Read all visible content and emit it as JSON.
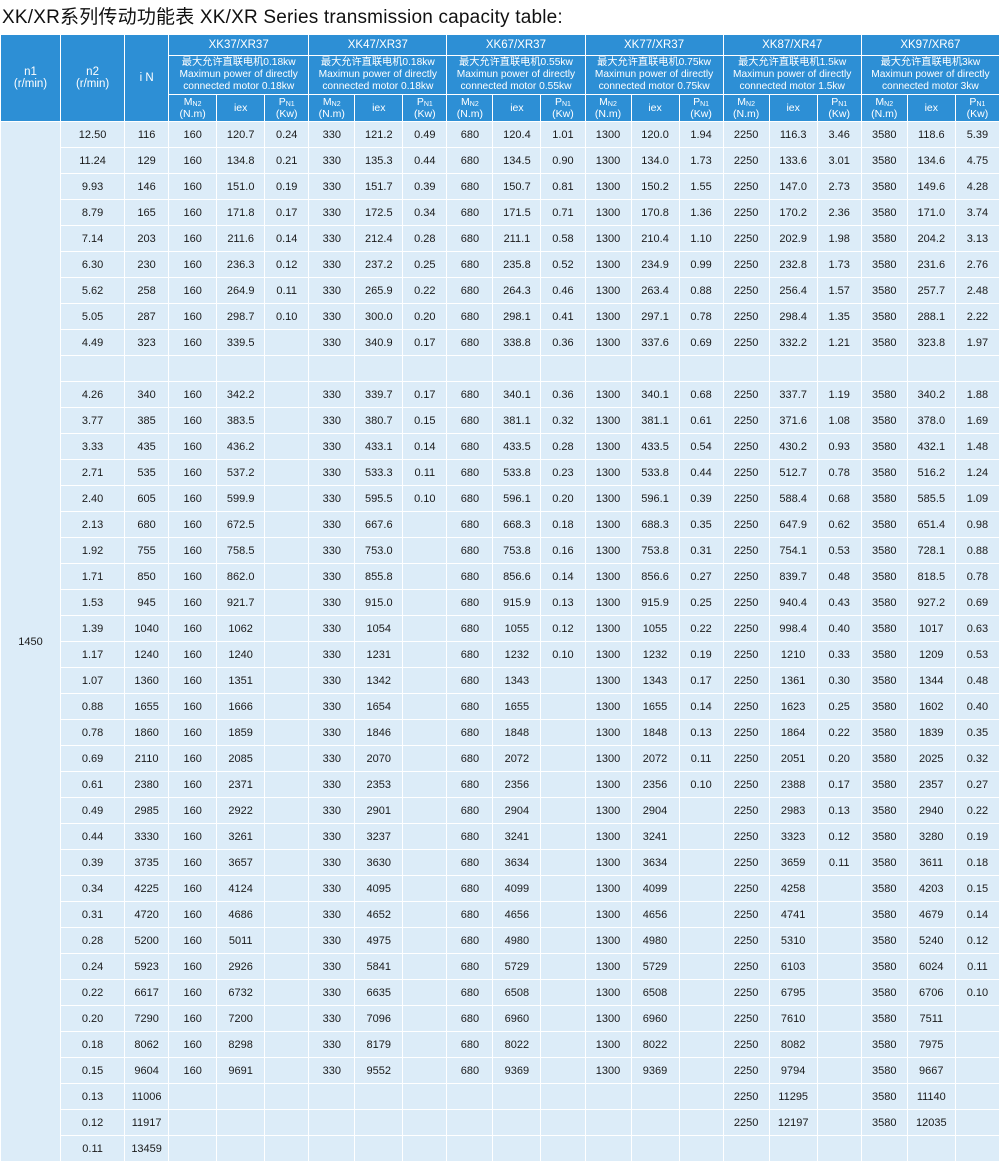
{
  "title": "XK/XR系列传动功能表  XK/XR Series transmission capacity table:",
  "headers": {
    "n1": "n1",
    "n1_unit": "(r/min)",
    "n2": "n2",
    "n2_unit": "(r/min)",
    "iN": "i N",
    "m_sym": "M",
    "m_sub": "N2",
    "m_unit": "(N.m)",
    "iex": "iex",
    "p_sym": "P",
    "p_sub": "N1",
    "p_unit": "(Kw)"
  },
  "models": [
    {
      "name": "XK37/XR37",
      "cn": "最大允许直联电机0.18kw",
      "en1": "Maximun power of directly",
      "en2": "connected motor 0.18kw"
    },
    {
      "name": "XK47/XR37",
      "cn": "最大允许直联电机0.18kw",
      "en1": "Maximun power of directly",
      "en2": "connected motor 0.18kw"
    },
    {
      "name": "XK67/XR37",
      "cn": "最大允许直联电机0.55kw",
      "en1": "Maximun power of directly",
      "en2": "connected motor 0.55kw"
    },
    {
      "name": "XK77/XR37",
      "cn": "最大允许直联电机0.75kw",
      "en1": "Maximun power of directly",
      "en2": "connected motor 0.75kw"
    },
    {
      "name": "XK87/XR47",
      "cn": "最大允许直联电机1.5kw",
      "en1": "Maximun power of directly",
      "en2": "connected motor 1.5kw"
    },
    {
      "name": "XK97/XR67",
      "cn": "最大允许直联电机3kw",
      "en1": "Maximun power of directly",
      "en2": "connected motor 3kw"
    }
  ],
  "n1_value": "1450",
  "rows": [
    [
      "12.50",
      "116",
      "160",
      "120.7",
      "0.24",
      "330",
      "121.2",
      "0.49",
      "680",
      "120.4",
      "1.01",
      "1300",
      "120.0",
      "1.94",
      "2250",
      "116.3",
      "3.46",
      "3580",
      "118.6",
      "5.39"
    ],
    [
      "11.24",
      "129",
      "160",
      "134.8",
      "0.21",
      "330",
      "135.3",
      "0.44",
      "680",
      "134.5",
      "0.90",
      "1300",
      "134.0",
      "1.73",
      "2250",
      "133.6",
      "3.01",
      "3580",
      "134.6",
      "4.75"
    ],
    [
      "9.93",
      "146",
      "160",
      "151.0",
      "0.19",
      "330",
      "151.7",
      "0.39",
      "680",
      "150.7",
      "0.81",
      "1300",
      "150.2",
      "1.55",
      "2250",
      "147.0",
      "2.73",
      "3580",
      "149.6",
      "4.28"
    ],
    [
      "8.79",
      "165",
      "160",
      "171.8",
      "0.17",
      "330",
      "172.5",
      "0.34",
      "680",
      "171.5",
      "0.71",
      "1300",
      "170.8",
      "1.36",
      "2250",
      "170.2",
      "2.36",
      "3580",
      "171.0",
      "3.74"
    ],
    [
      "7.14",
      "203",
      "160",
      "211.6",
      "0.14",
      "330",
      "212.4",
      "0.28",
      "680",
      "211.1",
      "0.58",
      "1300",
      "210.4",
      "1.10",
      "2250",
      "202.9",
      "1.98",
      "3580",
      "204.2",
      "3.13"
    ],
    [
      "6.30",
      "230",
      "160",
      "236.3",
      "0.12",
      "330",
      "237.2",
      "0.25",
      "680",
      "235.8",
      "0.52",
      "1300",
      "234.9",
      "0.99",
      "2250",
      "232.8",
      "1.73",
      "3580",
      "231.6",
      "2.76"
    ],
    [
      "5.62",
      "258",
      "160",
      "264.9",
      "0.11",
      "330",
      "265.9",
      "0.22",
      "680",
      "264.3",
      "0.46",
      "1300",
      "263.4",
      "0.88",
      "2250",
      "256.4",
      "1.57",
      "3580",
      "257.7",
      "2.48"
    ],
    [
      "5.05",
      "287",
      "160",
      "298.7",
      "0.10",
      "330",
      "300.0",
      "0.20",
      "680",
      "298.1",
      "0.41",
      "1300",
      "297.1",
      "0.78",
      "2250",
      "298.4",
      "1.35",
      "3580",
      "288.1",
      "2.22"
    ],
    [
      "4.49",
      "323",
      "160",
      "339.5",
      "",
      "330",
      "340.9",
      "0.17",
      "680",
      "338.8",
      "0.36",
      "1300",
      "337.6",
      "0.69",
      "2250",
      "332.2",
      "1.21",
      "3580",
      "323.8",
      "1.97"
    ],
    [
      "",
      "",
      "",
      "",
      "",
      "",
      "",
      "",
      "",
      "",
      "",
      "",
      "",
      "",
      "",
      "",
      "",
      "",
      "",
      ""
    ],
    [
      "4.26",
      "340",
      "160",
      "342.2",
      "",
      "330",
      "339.7",
      "0.17",
      "680",
      "340.1",
      "0.36",
      "1300",
      "340.1",
      "0.68",
      "2250",
      "337.7",
      "1.19",
      "3580",
      "340.2",
      "1.88"
    ],
    [
      "3.77",
      "385",
      "160",
      "383.5",
      "",
      "330",
      "380.7",
      "0.15",
      "680",
      "381.1",
      "0.32",
      "1300",
      "381.1",
      "0.61",
      "2250",
      "371.6",
      "1.08",
      "3580",
      "378.0",
      "1.69"
    ],
    [
      "3.33",
      "435",
      "160",
      "436.2",
      "",
      "330",
      "433.1",
      "0.14",
      "680",
      "433.5",
      "0.28",
      "1300",
      "433.5",
      "0.54",
      "2250",
      "430.2",
      "0.93",
      "3580",
      "432.1",
      "1.48"
    ],
    [
      "2.71",
      "535",
      "160",
      "537.2",
      "",
      "330",
      "533.3",
      "0.11",
      "680",
      "533.8",
      "0.23",
      "1300",
      "533.8",
      "0.44",
      "2250",
      "512.7",
      "0.78",
      "3580",
      "516.2",
      "1.24"
    ],
    [
      "2.40",
      "605",
      "160",
      "599.9",
      "",
      "330",
      "595.5",
      "0.10",
      "680",
      "596.1",
      "0.20",
      "1300",
      "596.1",
      "0.39",
      "2250",
      "588.4",
      "0.68",
      "3580",
      "585.5",
      "1.09"
    ],
    [
      "2.13",
      "680",
      "160",
      "672.5",
      "",
      "330",
      "667.6",
      "",
      "680",
      "668.3",
      "0.18",
      "1300",
      "688.3",
      "0.35",
      "2250",
      "647.9",
      "0.62",
      "3580",
      "651.4",
      "0.98"
    ],
    [
      "1.92",
      "755",
      "160",
      "758.5",
      "",
      "330",
      "753.0",
      "",
      "680",
      "753.8",
      "0.16",
      "1300",
      "753.8",
      "0.31",
      "2250",
      "754.1",
      "0.53",
      "3580",
      "728.1",
      "0.88"
    ],
    [
      "1.71",
      "850",
      "160",
      "862.0",
      "",
      "330",
      "855.8",
      "",
      "680",
      "856.6",
      "0.14",
      "1300",
      "856.6",
      "0.27",
      "2250",
      "839.7",
      "0.48",
      "3580",
      "818.5",
      "0.78"
    ],
    [
      "1.53",
      "945",
      "160",
      "921.7",
      "",
      "330",
      "915.0",
      "",
      "680",
      "915.9",
      "0.13",
      "1300",
      "915.9",
      "0.25",
      "2250",
      "940.4",
      "0.43",
      "3580",
      "927.2",
      "0.69"
    ],
    [
      "1.39",
      "1040",
      "160",
      "1062",
      "",
      "330",
      "1054",
      "",
      "680",
      "1055",
      "0.12",
      "1300",
      "1055",
      "0.22",
      "2250",
      "998.4",
      "0.40",
      "3580",
      "1017",
      "0.63"
    ],
    [
      "1.17",
      "1240",
      "160",
      "1240",
      "",
      "330",
      "1231",
      "",
      "680",
      "1232",
      "0.10",
      "1300",
      "1232",
      "0.19",
      "2250",
      "1210",
      "0.33",
      "3580",
      "1209",
      "0.53"
    ],
    [
      "1.07",
      "1360",
      "160",
      "1351",
      "",
      "330",
      "1342",
      "",
      "680",
      "1343",
      "",
      "1300",
      "1343",
      "0.17",
      "2250",
      "1361",
      "0.30",
      "3580",
      "1344",
      "0.48"
    ],
    [
      "0.88",
      "1655",
      "160",
      "1666",
      "",
      "330",
      "1654",
      "",
      "680",
      "1655",
      "",
      "1300",
      "1655",
      "0.14",
      "2250",
      "1623",
      "0.25",
      "3580",
      "1602",
      "0.40"
    ],
    [
      "0.78",
      "1860",
      "160",
      "1859",
      "",
      "330",
      "1846",
      "",
      "680",
      "1848",
      "",
      "1300",
      "1848",
      "0.13",
      "2250",
      "1864",
      "0.22",
      "3580",
      "1839",
      "0.35"
    ],
    [
      "0.69",
      "2110",
      "160",
      "2085",
      "",
      "330",
      "2070",
      "",
      "680",
      "2072",
      "",
      "1300",
      "2072",
      "0.11",
      "2250",
      "2051",
      "0.20",
      "3580",
      "2025",
      "0.32"
    ],
    [
      "0.61",
      "2380",
      "160",
      "2371",
      "",
      "330",
      "2353",
      "",
      "680",
      "2356",
      "",
      "1300",
      "2356",
      "0.10",
      "2250",
      "2388",
      "0.17",
      "3580",
      "2357",
      "0.27"
    ],
    [
      "0.49",
      "2985",
      "160",
      "2922",
      "",
      "330",
      "2901",
      "",
      "680",
      "2904",
      "",
      "1300",
      "2904",
      "",
      "2250",
      "2983",
      "0.13",
      "3580",
      "2940",
      "0.22"
    ],
    [
      "0.44",
      "3330",
      "160",
      "3261",
      "",
      "330",
      "3237",
      "",
      "680",
      "3241",
      "",
      "1300",
      "3241",
      "",
      "2250",
      "3323",
      "0.12",
      "3580",
      "3280",
      "0.19"
    ],
    [
      "0.39",
      "3735",
      "160",
      "3657",
      "",
      "330",
      "3630",
      "",
      "680",
      "3634",
      "",
      "1300",
      "3634",
      "",
      "2250",
      "3659",
      "0.11",
      "3580",
      "3611",
      "0.18"
    ],
    [
      "0.34",
      "4225",
      "160",
      "4124",
      "",
      "330",
      "4095",
      "",
      "680",
      "4099",
      "",
      "1300",
      "4099",
      "",
      "2250",
      "4258",
      "",
      "3580",
      "4203",
      "0.15"
    ],
    [
      "0.31",
      "4720",
      "160",
      "4686",
      "",
      "330",
      "4652",
      "",
      "680",
      "4656",
      "",
      "1300",
      "4656",
      "",
      "2250",
      "4741",
      "",
      "3580",
      "4679",
      "0.14"
    ],
    [
      "0.28",
      "5200",
      "160",
      "5011",
      "",
      "330",
      "4975",
      "",
      "680",
      "4980",
      "",
      "1300",
      "4980",
      "",
      "2250",
      "5310",
      "",
      "3580",
      "5240",
      "0.12"
    ],
    [
      "0.24",
      "5923",
      "160",
      "2926",
      "",
      "330",
      "5841",
      "",
      "680",
      "5729",
      "",
      "1300",
      "5729",
      "",
      "2250",
      "6103",
      "",
      "3580",
      "6024",
      "0.11"
    ],
    [
      "0.22",
      "6617",
      "160",
      "6732",
      "",
      "330",
      "6635",
      "",
      "680",
      "6508",
      "",
      "1300",
      "6508",
      "",
      "2250",
      "6795",
      "",
      "3580",
      "6706",
      "0.10"
    ],
    [
      "0.20",
      "7290",
      "160",
      "7200",
      "",
      "330",
      "7096",
      "",
      "680",
      "6960",
      "",
      "1300",
      "6960",
      "",
      "2250",
      "7610",
      "",
      "3580",
      "7511",
      ""
    ],
    [
      "0.18",
      "8062",
      "160",
      "8298",
      "",
      "330",
      "8179",
      "",
      "680",
      "8022",
      "",
      "1300",
      "8022",
      "",
      "2250",
      "8082",
      "",
      "3580",
      "7975",
      ""
    ],
    [
      "0.15",
      "9604",
      "160",
      "9691",
      "",
      "330",
      "9552",
      "",
      "680",
      "9369",
      "",
      "1300",
      "9369",
      "",
      "2250",
      "9794",
      "",
      "3580",
      "9667",
      ""
    ],
    [
      "0.13",
      "11006",
      "",
      "",
      "",
      "",
      "",
      "",
      "",
      "",
      "",
      "",
      "",
      "",
      "2250",
      "11295",
      "",
      "3580",
      "11140",
      ""
    ],
    [
      "0.12",
      "11917",
      "",
      "",
      "",
      "",
      "",
      "",
      "",
      "",
      "",
      "",
      "",
      "",
      "2250",
      "12197",
      "",
      "3580",
      "12035",
      ""
    ],
    [
      "0.11",
      "13459",
      "",
      "",
      "",
      "",
      "",
      "",
      "",
      "",
      "",
      "",
      "",
      "",
      "",
      "",
      "",
      "",
      "",
      ""
    ]
  ]
}
